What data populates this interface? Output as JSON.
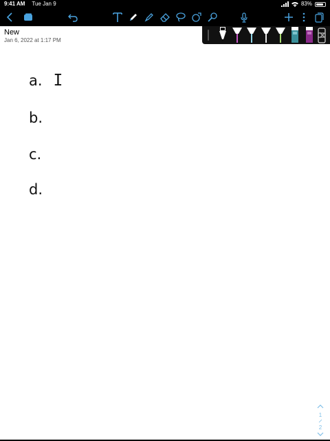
{
  "status_bar": {
    "time": "9:41 AM",
    "date": "Tue Jan 9",
    "battery": "83%",
    "battery_level": 0.83
  },
  "toolbar": {
    "left_icons": [
      "chevron-left-icon",
      "notebooks-icon",
      "undo-icon"
    ],
    "tool_icons": [
      "text-tool-icon",
      "pen-tool-icon",
      "highlighter-icon",
      "eraser-icon",
      "lasso-icon",
      "shapes-icon",
      "laser-pointer-icon"
    ],
    "right_icons": [
      "microphone-icon",
      "plus-icon",
      "more-icon",
      "pages-icon"
    ]
  },
  "document": {
    "title": "New",
    "date": "Jan 6, 2022 at 1:17 PM"
  },
  "pen_palette": {
    "pens": [
      {
        "name": "black-pen",
        "color": "#111111"
      },
      {
        "name": "magenta-highlighter",
        "color": "#c85ac8"
      },
      {
        "name": "cyan-highlighter",
        "color": "#8fd3e6"
      },
      {
        "name": "gray-highlighter",
        "color": "#e8e8e8"
      },
      {
        "name": "green-highlighter",
        "color": "#a6d86f"
      },
      {
        "name": "teal-marker",
        "color": "#3a8f9a"
      },
      {
        "name": "purple-marker",
        "color": "#8a2a8a"
      },
      {
        "name": "eraser-pen",
        "color": "#dddddd"
      }
    ]
  },
  "handwriting": [
    {
      "label": "a.",
      "answer": "I"
    },
    {
      "label": "b.",
      "answer": ""
    },
    {
      "label": "c.",
      "answer": ""
    },
    {
      "label": "d.",
      "answer": ""
    }
  ],
  "page_nav": {
    "current": "1",
    "total": "2"
  },
  "colors": {
    "accent": "#4aa3df",
    "toolbar": "#000000",
    "page": "#ffffff"
  }
}
